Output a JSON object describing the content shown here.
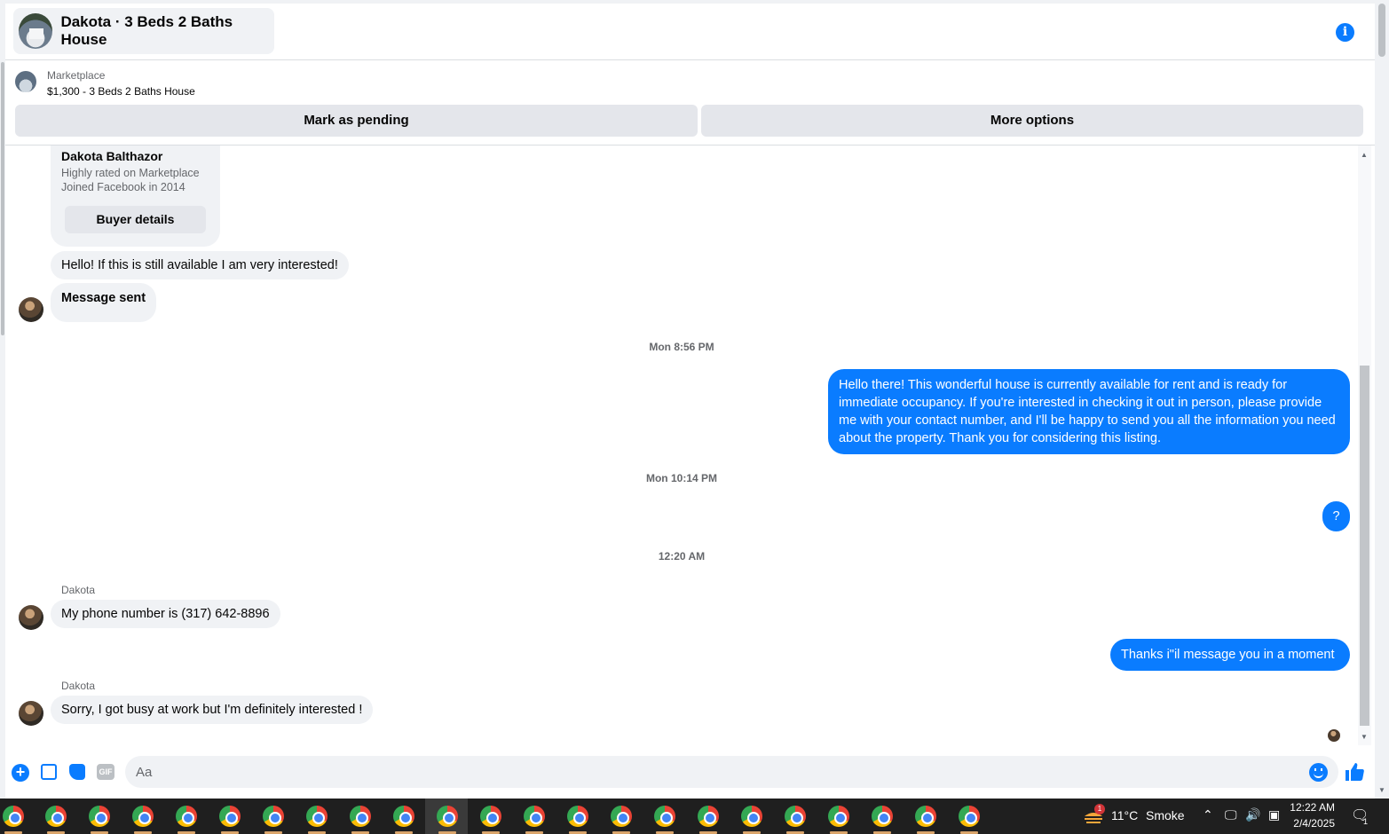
{
  "header": {
    "title": "Dakota · 3 Beds 2 Baths House"
  },
  "listing": {
    "source": "Marketplace",
    "price_title": "$1,300 - 3 Beds 2 Baths House",
    "mark_pending": "Mark as pending",
    "more_options": "More options"
  },
  "profile_card": {
    "name": "Dakota Balthazor",
    "line1": "Highly rated on Marketplace",
    "line2": "Joined Facebook in 2014",
    "button": "Buyer details"
  },
  "messages": {
    "m1": "Hello! If this is still available I am very interested!",
    "m2": "Message sent",
    "ts1": "Mon 8:56 PM",
    "m3": "Hello there! This wonderful house is currently available for rent and is ready for immediate occupancy. If you're interested in checking it out in person, please provide me with your contact number, and I'll be happy to send you all the information you need about the property. Thank you for considering this listing.",
    "ts2": "Mon 10:14 PM",
    "m4": "?",
    "ts3": "12:20 AM",
    "sender1": "Dakota",
    "m5": "My phone number is (317) 642-8896",
    "m6": "Thanks i\"il message you in a moment",
    "sender2": "Dakota",
    "m7": "Sorry, I got busy at work but I'm definitely interested !"
  },
  "composer": {
    "placeholder": "Aa",
    "gif_label": "GIF"
  },
  "taskbar": {
    "weather_temp": "11°C",
    "weather_desc": "Smoke",
    "time": "12:22 AM",
    "date": "2/4/2025",
    "notification_count": "1",
    "weather_badge": "1"
  },
  "colors": {
    "messenger_blue": "#0a7cff",
    "bubble_gray": "#f0f2f5",
    "taskbar": "#1f1f1f"
  }
}
